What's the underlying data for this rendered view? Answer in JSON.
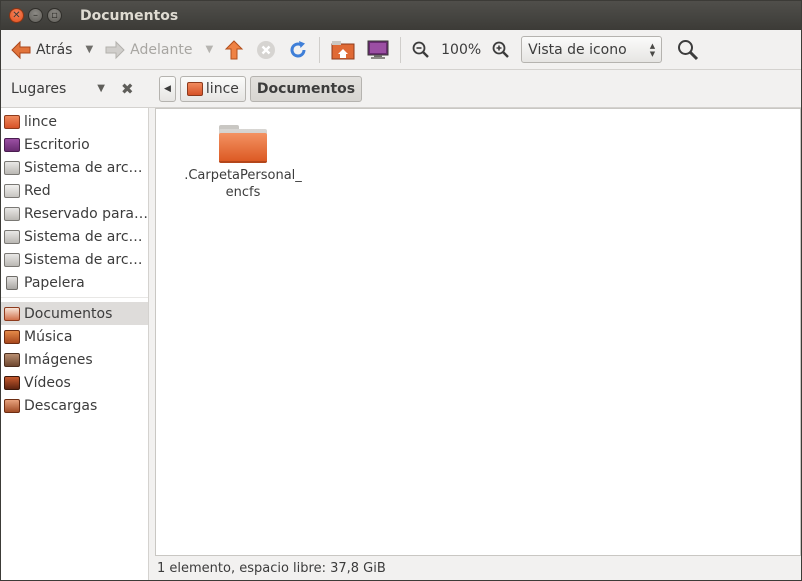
{
  "window": {
    "title": "Documentos"
  },
  "toolbar": {
    "back_label": "Atrás",
    "forward_label": "Adelante",
    "zoom_level": "100%",
    "view_mode": "Vista de icono"
  },
  "places": {
    "header": "Lugares",
    "items": [
      {
        "label": "lince",
        "icon": "home-folder-icon"
      },
      {
        "label": "Escritorio",
        "icon": "desktop-icon"
      },
      {
        "label": "Sistema de arc…",
        "icon": "drive-icon"
      },
      {
        "label": "Red",
        "icon": "network-icon"
      },
      {
        "label": "Reservado para…",
        "icon": "drive-icon"
      },
      {
        "label": "Sistema de arc…",
        "icon": "drive-icon"
      },
      {
        "label": "Sistema de arc…",
        "icon": "drive-icon"
      },
      {
        "label": "Papelera",
        "icon": "trash-icon"
      }
    ],
    "bookmarks": [
      {
        "label": "Documentos",
        "icon": "documents-folder-icon",
        "selected": true
      },
      {
        "label": "Música",
        "icon": "music-folder-icon"
      },
      {
        "label": "Imágenes",
        "icon": "pictures-folder-icon"
      },
      {
        "label": "Vídeos",
        "icon": "videos-folder-icon"
      },
      {
        "label": "Descargas",
        "icon": "downloads-folder-icon"
      }
    ]
  },
  "breadcrumb": {
    "parent": "lince",
    "current": "Documentos"
  },
  "files": [
    {
      "name_line1": ".CarpetaPersonal_",
      "name_line2": "encfs",
      "icon": "folder-icon"
    }
  ],
  "statusbar": {
    "text": "1 elemento, espacio libre: 37,8 GiB"
  }
}
